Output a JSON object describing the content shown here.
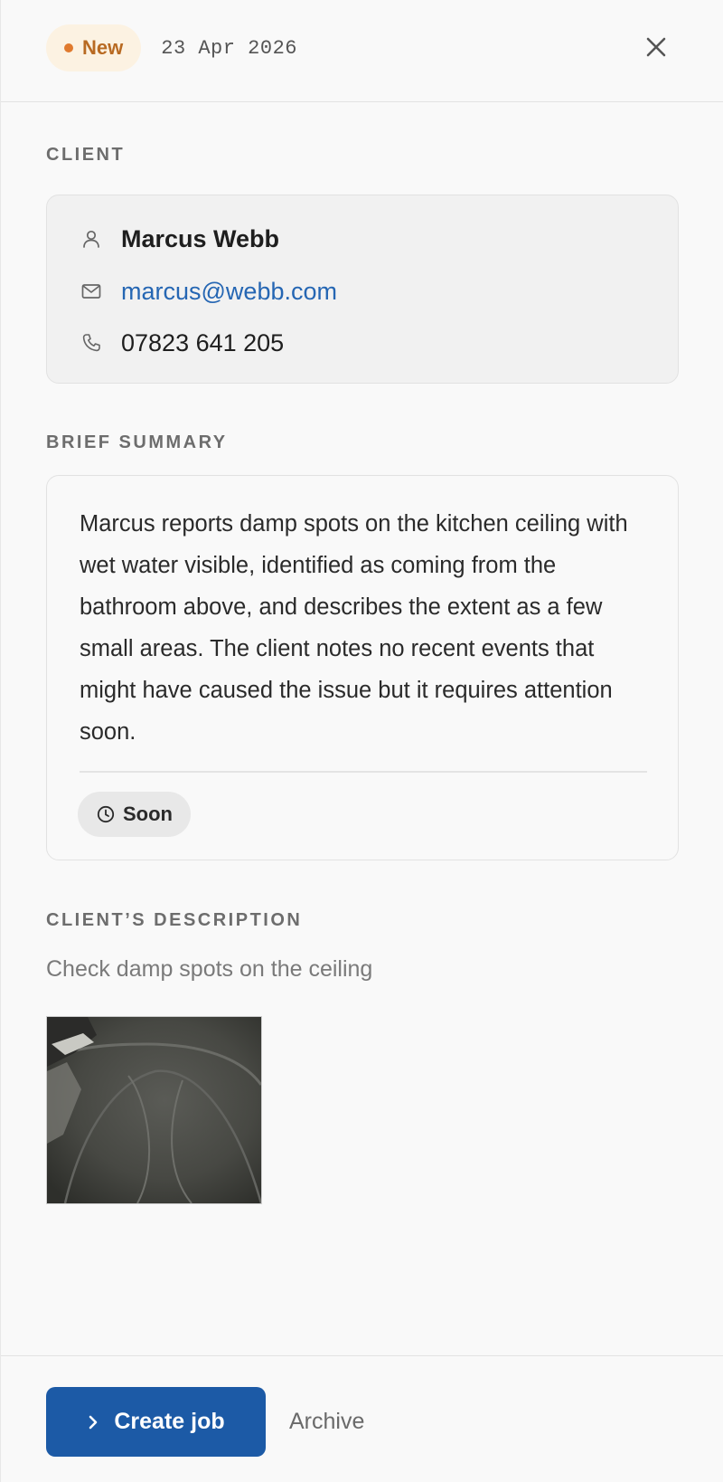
{
  "header": {
    "status": "New",
    "date": "23 Apr 2026",
    "close_icon": "close-icon"
  },
  "client": {
    "section_label": "CLIENT",
    "name": "Marcus Webb",
    "email": "marcus@webb.com",
    "phone": "07823 641 205",
    "icons": [
      "person-icon",
      "mail-icon",
      "phone-icon"
    ]
  },
  "summary": {
    "section_label": "BRIEF SUMMARY",
    "text": "Marcus reports damp spots on the kitchen ceiling with wet water visible, identified as coming from the bathroom above, and describes the extent as a few small areas. The client notes no recent events that might have caused the issue but it requires attention soon.",
    "urgency": "Soon",
    "urgency_icon": "clock-icon"
  },
  "description": {
    "section_label": "CLIENT’S DESCRIPTION",
    "text": "Check damp spots on the ceiling"
  },
  "footer": {
    "create_label": "Create job",
    "archive_label": "Archive"
  },
  "colors": {
    "accent": "#1c5aa6",
    "status_new": "#e07a2e",
    "link": "#2566b3"
  }
}
